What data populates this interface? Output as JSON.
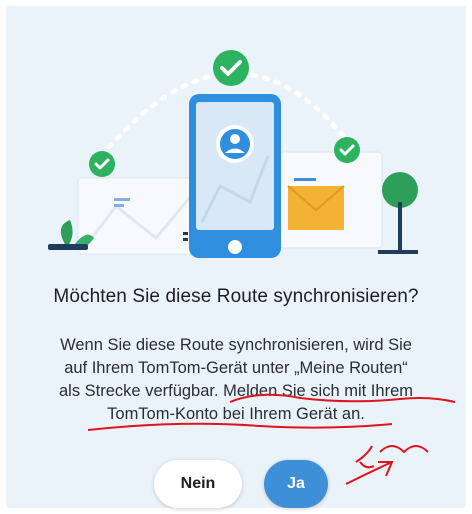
{
  "dialog": {
    "title": "Möchten Sie diese Route synchronisieren?",
    "body_line1": "Wenn Sie diese Route synchronisieren, wird Sie",
    "body_line2": "auf Ihrem TomTom-Gerät unter „Meine Routen“",
    "body_line3_a": "als Strecke verfügbar. ",
    "body_line3_b": "Melden Sie sich mit Ihrem",
    "body_line4": "TomTom-Konto bei Ihrem Gerät an.",
    "no_label": "Nein",
    "yes_label": "Ja"
  },
  "colors": {
    "background": "#eaf2fa",
    "accent_blue": "#3d90d8",
    "check_green": "#2db25f",
    "annotation_red": "#e0141e"
  },
  "icons": [
    "check-icon",
    "user-icon",
    "phone-icon",
    "tree-icon",
    "plant-icon"
  ]
}
